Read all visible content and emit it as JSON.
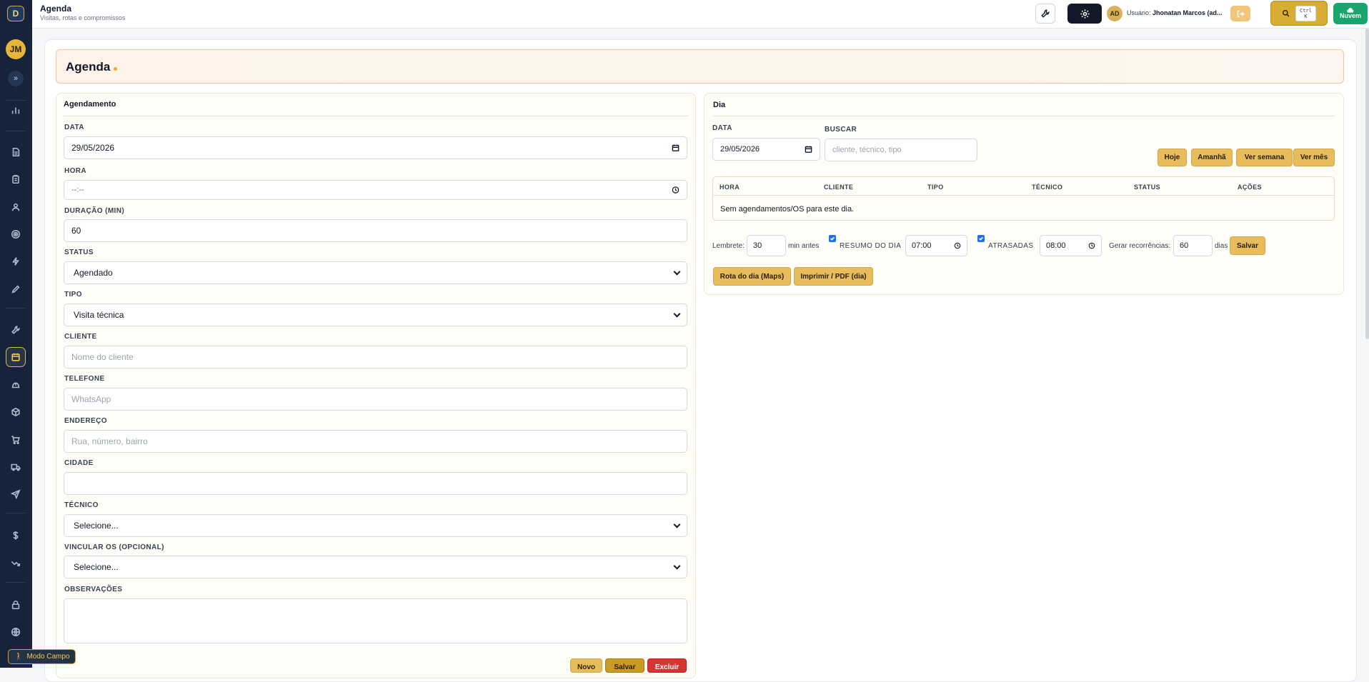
{
  "sidebar": {
    "logo": "D",
    "avatar": "JM",
    "expand": "»",
    "icons": [
      "chart-icon",
      "file-icon",
      "clipboard-icon",
      "user-icon",
      "target-icon",
      "bolt-icon",
      "pen-icon",
      "wrench-icon",
      "calendar-icon",
      "helmet-icon",
      "box-icon",
      "cart-icon",
      "truck-icon",
      "send-icon",
      "dollar-icon",
      "trend-icon",
      "lock-icon",
      "globe-icon"
    ],
    "active": "calendar-icon",
    "modo_campo": "Modo Campo"
  },
  "topbar": {
    "title": "Agenda",
    "subtitle": "Visitas, rotas e compromissos",
    "avatar": "AD",
    "user_prefix": "Usuário:",
    "user_name": "Jhonatan Marcos (ad...",
    "shortcut_line1": "Ctrl",
    "shortcut_line2": "K",
    "cloud_label": "Nuvem"
  },
  "page": {
    "title": "Agenda"
  },
  "agendamento": {
    "title": "Agendamento",
    "data_label": "DATA",
    "data_value": "29/05/2026",
    "hora_label": "HORA",
    "hora_value": "--:--",
    "duracao_label": "DURAÇÃO (MIN)",
    "duracao_value": "60",
    "status_label": "STATUS",
    "status_value": "Agendado",
    "tipo_label": "TIPO",
    "tipo_value": "Visita técnica",
    "cliente_label": "CLIENTE",
    "cliente_placeholder": "Nome do cliente",
    "telefone_label": "TELEFONE",
    "telefone_placeholder": "WhatsApp",
    "endereco_label": "ENDEREÇO",
    "endereco_placeholder": "Rua, número, bairro",
    "cidade_label": "CIDADE",
    "cidade_value": "",
    "tecnico_label": "TÉCNICO",
    "tecnico_value": "Selecione...",
    "vincular_label": "VINCULAR OS (OPCIONAL)",
    "vincular_value": "Selecione...",
    "observacoes_label": "OBSERVAÇÕES",
    "btn_novo": "Novo",
    "btn_salvar": "Salvar",
    "btn_excluir": "Excluir"
  },
  "dia": {
    "title": "Dia",
    "data_label": "DATA",
    "data_value": "29/05/2026",
    "buscar_label": "BUSCAR",
    "buscar_placeholder": "cliente, técnico, tipo",
    "btn_hoje": "Hoje",
    "btn_amanha": "Amanhã",
    "btn_semana": "Ver semana",
    "btn_mes": "Ver mês",
    "columns": [
      "HORA",
      "CLIENTE",
      "TIPO",
      "TÉCNICO",
      "STATUS",
      "AÇÕES"
    ],
    "empty_message": "Sem agendamentos/OS para este dia.",
    "lembrete_label": "Lembrete:",
    "lembrete_value": "30",
    "lembrete_suffix": "min antes",
    "resumo_label": "RESUMO DO DIA",
    "resumo_checked": true,
    "resumo_time": "07:00",
    "atrasadas_label": "ATRASADAS",
    "atrasadas_checked": true,
    "atrasadas_time": "08:00",
    "recorrencias_label": "Gerar recorrências:",
    "recorrencias_value": "60",
    "recorrencias_suffix": "dias",
    "btn_salvar": "Salvar",
    "btn_rota": "Rota do dia (Maps)",
    "btn_imprimir": "Imprimir / PDF (dia)"
  },
  "colors": {
    "sidebar_bg": "#16233a",
    "accent_gold": "#e6bc5c",
    "danger": "#d93434",
    "success": "#18a66c"
  }
}
